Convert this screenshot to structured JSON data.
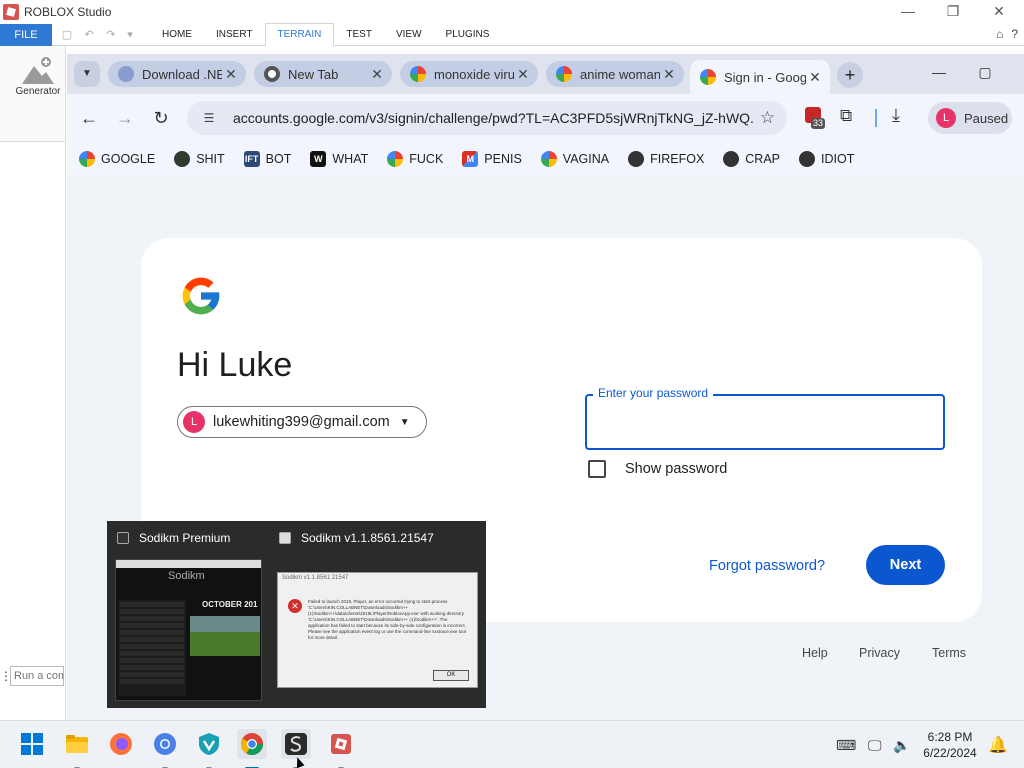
{
  "roblox": {
    "window_title": "ROBLOX Studio",
    "file_label": "FILE",
    "tabs": [
      "HOME",
      "INSERT",
      "TERRAIN",
      "TEST",
      "VIEW",
      "PLUGINS"
    ],
    "active_tab": "TERRAIN",
    "generator_label": "Generator",
    "command_placeholder": "Run a command"
  },
  "chrome": {
    "tabs": [
      {
        "title": "Download .NET",
        "icon": "dotnet-icon",
        "color": "#8a9bd1"
      },
      {
        "title": "New Tab",
        "icon": "chrome-icon",
        "color": "#333333"
      },
      {
        "title": "monoxide virus",
        "icon": "google-icon",
        "color": "#4285f4"
      },
      {
        "title": "anime woman",
        "icon": "google-icon",
        "color": "#4285f4"
      },
      {
        "title": "Sign in - Google",
        "icon": "google-icon",
        "color": "#4285f4",
        "active": true
      }
    ],
    "url": "accounts.google.com/v3/signin/challenge/pwd?TL=AC3PFD5sjWRnjTkNG_jZ-hWQ...",
    "extension_badge": "33",
    "profile": {
      "initial": "L",
      "label": "Paused"
    },
    "bookmarks": [
      {
        "label": "GOOGLE",
        "icon": "google-icon",
        "color": "#4285f4"
      },
      {
        "label": "SHIT",
        "icon": "shit-site-icon",
        "color": "#2e3b2e"
      },
      {
        "label": "BOT",
        "icon": "bot-site-icon",
        "color": "#2b4a7a"
      },
      {
        "label": "WHAT",
        "icon": "w-site-icon",
        "color": "#111111"
      },
      {
        "label": "FUCK",
        "icon": "google-icon",
        "color": "#4285f4"
      },
      {
        "label": "PENIS",
        "icon": "gmail-icon",
        "color": "#d93025"
      },
      {
        "label": "VAGINA",
        "icon": "google-icon",
        "color": "#4285f4"
      },
      {
        "label": "FIREFOX",
        "icon": "globe-icon",
        "color": "#333333"
      },
      {
        "label": "CRAP",
        "icon": "globe-icon",
        "color": "#333333"
      },
      {
        "label": "IDIOT",
        "icon": "globe-icon",
        "color": "#333333"
      }
    ]
  },
  "signin": {
    "greeting": "Hi Luke",
    "avatar_initial": "L",
    "email": "lukewhiting399@gmail.com",
    "password_label": "Enter your password",
    "password_value": "",
    "show_password_label": "Show password",
    "forgot_label": "Forgot password?",
    "next_label": "Next",
    "footer": [
      "Help",
      "Privacy",
      "Terms"
    ],
    "colors": {
      "primary": "#0b57d0",
      "background": "#f0f4f9"
    }
  },
  "preview": {
    "windows": [
      {
        "title": "Sodikm Premium",
        "brand": "Sodikm",
        "banner": "OCTOBER 201"
      },
      {
        "title": "Sodikm v1.1.8561.21547",
        "dialog_title": "Sodikm v1.1.8561.21547",
        "dialog_text": "Failed to launch 2019, Player, an error occurred trying to start process 'C:\\Users\\KIN.COLLABNET\\Downloads\\Sodikm++ (1)\\Sodikm++\\data\\clients\\2019L\\Player\\RobloxApp.exe' with working directory 'C:\\Users\\KIN.COLLABNET\\Downloads\\Sodikm++ (1)\\Sodikm++'. The application has failed to start because its side-by-side configuration is incorrect. Please see the application event log or use the command-line sxstrace.exe tool for more detail.",
        "ok_label": "OK"
      }
    ]
  },
  "taskbar": {
    "apps": [
      "start-icon",
      "file-explorer-icon",
      "firefox-icon",
      "chromium-icon",
      "vpn-icon",
      "chrome-icon",
      "sodikm-icon",
      "roblox-studio-icon"
    ],
    "time": "6:28 PM",
    "date": "6/22/2024"
  }
}
